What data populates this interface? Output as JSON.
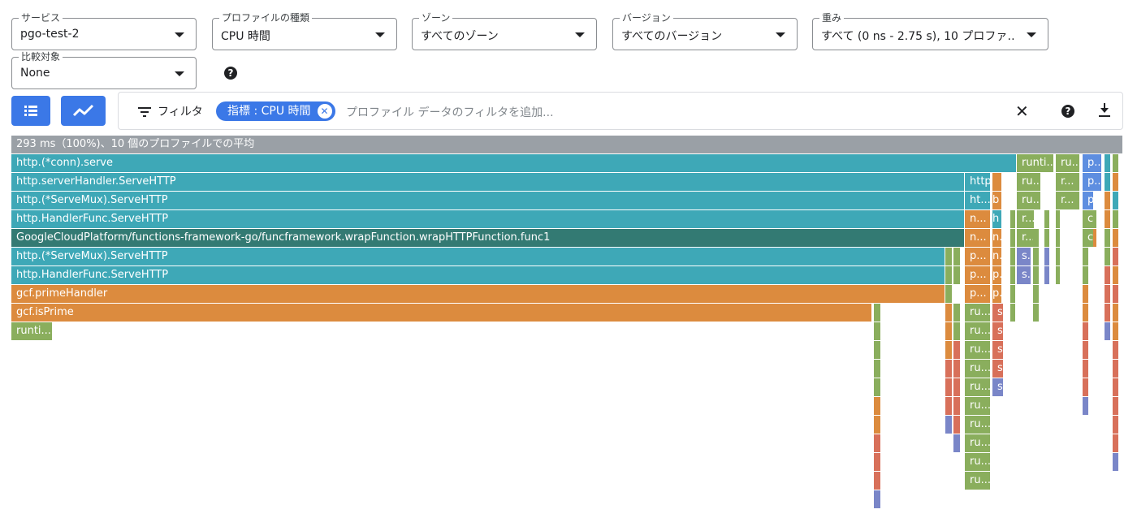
{
  "selectors": {
    "service": {
      "label": "サービス",
      "value": "pgo-test-2"
    },
    "profile_type": {
      "label": "プロファイルの種類",
      "value": "CPU 時間"
    },
    "zone": {
      "label": "ゾーン",
      "value": "すべてのゾーン"
    },
    "version": {
      "label": "バージョン",
      "value": "すべてのバージョン"
    },
    "weight": {
      "label": "重み",
      "value": "すべて (0 ns - 2.75 s), 10 プロファ…"
    },
    "compare": {
      "label": "比較対象",
      "value": "None"
    }
  },
  "toolbar": {
    "icons": [
      "list-view-icon",
      "trend-view-icon"
    ],
    "filter_label": "フィルタ",
    "chip_label": "指標 : CPU 時間",
    "filter_placeholder": "プロファイル データのフィルタを追加...",
    "clear_icon": "✕",
    "help_icon": "?",
    "download_icon": "download-icon"
  },
  "colors": {
    "accent": "#3b78e7",
    "teal": "#3ea8b7",
    "orange": "#dc8b3e",
    "green": "#8aae5d",
    "red": "#d8705a",
    "purple": "#7a86c8",
    "blue": "#5e8ee0",
    "gray": "#9aa0a6",
    "darkteal": "#337a73"
  },
  "flame": {
    "header": "293 ms（100%)、10 個のプロファイルでの平均",
    "rows": [
      "http.(*conn).serve",
      "http.serverHandler.ServeHTTP",
      "http.(*ServeMux).ServeHTTP",
      "http.HandlerFunc.ServeHTTP",
      "GoogleCloudPlatform/functions-framework-go/funcframework.wrapFunction.wrapHTTPFunction.func1",
      "http.(*ServeMux).ServeHTTP",
      "http.HandlerFunc.ServeHTTP",
      "gcf.primeHandler",
      "gcf.isPrime",
      "runti..."
    ],
    "small_labels": [
      "runti...",
      "ru...",
      "p...",
      "http...",
      "ht...",
      "b",
      "n...",
      "h",
      "r...",
      "c",
      "p...",
      "s.",
      "ru...",
      "s",
      "ru..."
    ]
  }
}
